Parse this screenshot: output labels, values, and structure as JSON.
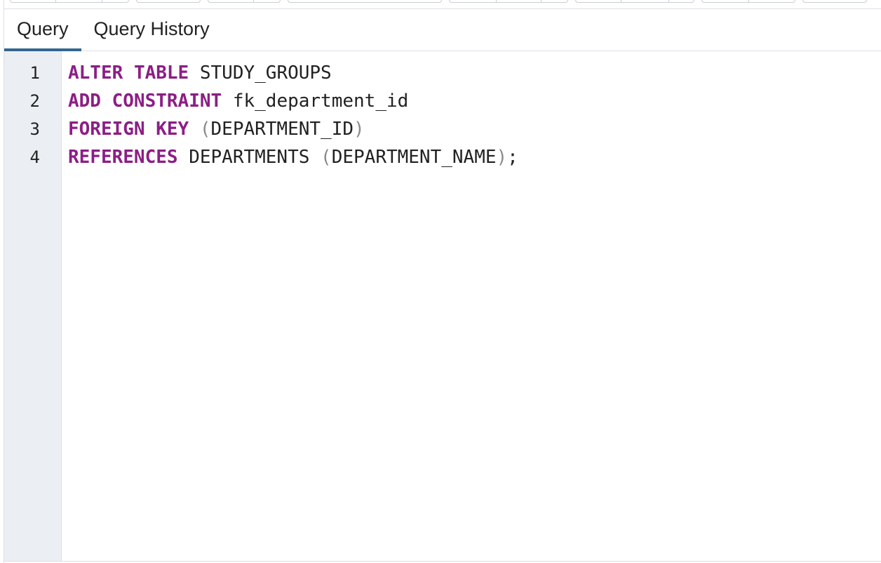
{
  "tabs": [
    {
      "label": "Query",
      "active": true
    },
    {
      "label": "Query History",
      "active": false
    }
  ],
  "editor": {
    "line_numbers": [
      "1",
      "2",
      "3",
      "4"
    ],
    "lines": [
      {
        "kw1": "ALTER",
        "kw2": "TABLE",
        "rest": "STUDY_GROUPS"
      },
      {
        "kw1": "ADD",
        "kw2": "CONSTRAINT",
        "rest": "fk_department_id"
      },
      {
        "kw1": "FOREIGN",
        "kw2": "KEY",
        "open": "(",
        "col": "DEPARTMENT_ID",
        "close": ")"
      },
      {
        "kw1": "REFERENCES",
        "table": "DEPARTMENTS",
        "open": "(",
        "col": "DEPARTMENT_NAME",
        "close": ")",
        "end": ";"
      }
    ]
  },
  "colors": {
    "keyword": "#8c1e86",
    "active_tab_indicator": "#326690",
    "gutter_background": "#ebeef3"
  }
}
